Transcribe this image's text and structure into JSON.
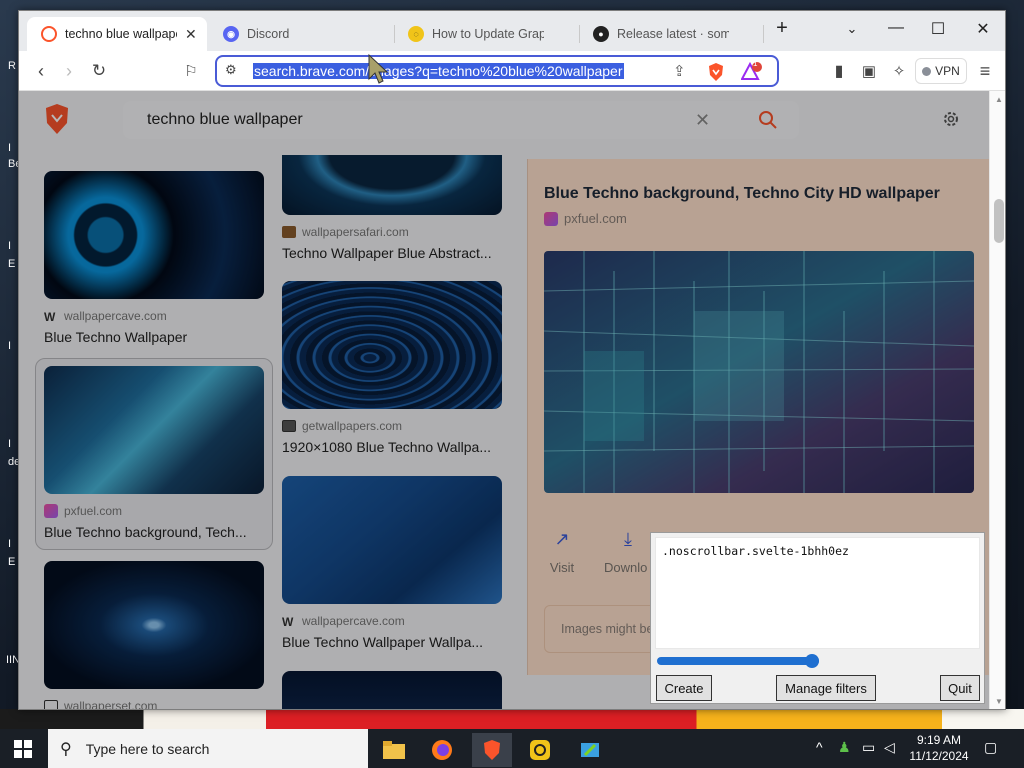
{
  "tabs": [
    {
      "label": "techno blue wallpaper",
      "active": true
    },
    {
      "label": "Discord",
      "active": false
    },
    {
      "label": "How to Update Graphics",
      "active": false
    },
    {
      "label": "Release latest · someone",
      "active": false
    }
  ],
  "toolbar": {
    "url": "search.brave.com/images?q=techno%20blue%20wallpaper",
    "shields_count": "1",
    "vpn_label": "VPN"
  },
  "search": {
    "query": "techno blue wallpaper"
  },
  "results": [
    {
      "source": "",
      "title": ""
    },
    {
      "source": "wallpapersafari.com",
      "title": "Techno Wallpaper Blue Abstract..."
    },
    {
      "source": "wallpapercave.com",
      "title": "Blue Techno Wallpaper"
    },
    {
      "source": "getwallpapers.com",
      "title": "1920×1080 Blue Techno Wallpa..."
    },
    {
      "source": "pxfuel.com",
      "title": "Blue Techno background, Tech..."
    },
    {
      "source": "wallpapercave.com",
      "title": "Blue Techno Wallpaper Wallpa..."
    },
    {
      "source": "wallpaperset.com",
      "title": ""
    }
  ],
  "detail": {
    "title": "Blue Techno background, Techno City HD wallpaper",
    "source": "pxfuel.com",
    "actions": [
      "Visit",
      "Downlo"
    ],
    "note": "Images might be"
  },
  "tool": {
    "selector": ".noscrollbar.svelte-1bhh0ez",
    "slider_value": 1.0,
    "create_label": "Create",
    "manage_label": "Manage filters",
    "quit_label": "Quit"
  },
  "taskbar": {
    "search_placeholder": "Type here to search",
    "time": "9:19 AM",
    "date": "11/12/2024"
  },
  "desktop_letters": [
    "R",
    "I",
    "Be",
    "I",
    "E",
    "I",
    "I",
    "de",
    "I",
    "E",
    "IIN"
  ],
  "colors": {
    "accent": "#3b5fe0",
    "brave_orange": "#fb542b",
    "detail_bg": "#ffe1cc"
  }
}
